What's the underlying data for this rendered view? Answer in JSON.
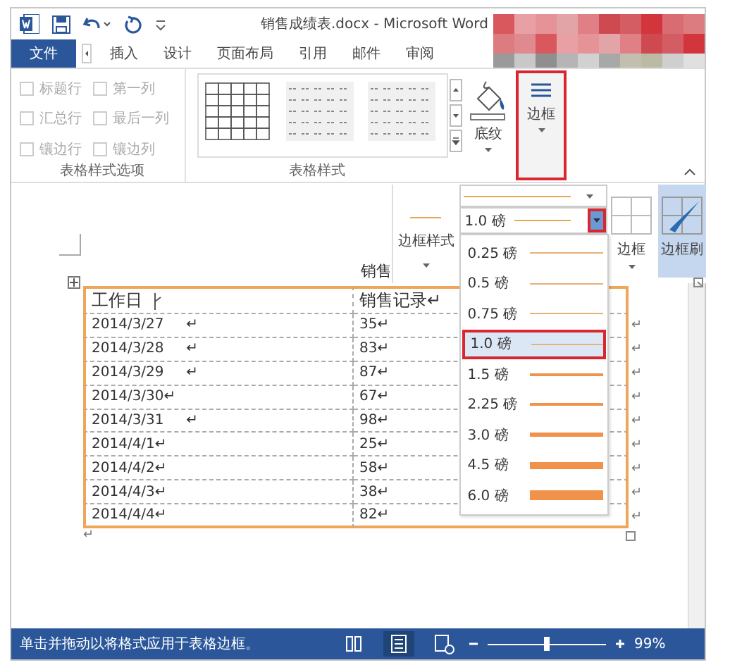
{
  "title_bar": {
    "title": "销售成绩表.docx - Microsoft Word"
  },
  "tabs": [
    {
      "label": "文件",
      "kind": "file"
    },
    {
      "label": "插入",
      "kind": "tab"
    },
    {
      "label": "设计",
      "kind": "tab"
    },
    {
      "label": "页面布局",
      "kind": "tab"
    },
    {
      "label": "引用",
      "kind": "tab"
    },
    {
      "label": "邮件",
      "kind": "tab"
    },
    {
      "label": "审阅",
      "kind": "tab"
    }
  ],
  "style_options": {
    "label": "表格样式选项",
    "options": [
      {
        "label": "标题行",
        "checked": false
      },
      {
        "label": "第一列",
        "checked": false
      },
      {
        "label": "汇总行",
        "checked": false
      },
      {
        "label": "最后一列",
        "checked": false
      },
      {
        "label": "镶边行",
        "checked": false
      },
      {
        "label": "镶边列",
        "checked": false
      }
    ]
  },
  "table_styles": {
    "label": "表格样式",
    "shading_button": "底纹",
    "borders_button": {
      "label": "边框",
      "highlighted": true
    }
  },
  "border_panel": {
    "style_button": "边框样式",
    "weight_combo": {
      "value": "1.0 磅",
      "highlighted": true
    },
    "borders_button": "边框",
    "painter_button": {
      "label": "边框刷",
      "on": true
    }
  },
  "weight_menu": [
    {
      "label": "0.25 磅",
      "selected": false
    },
    {
      "label": "0.5 磅",
      "selected": false
    },
    {
      "label": "0.75 磅",
      "selected": false
    },
    {
      "label": "1.0 磅",
      "selected": true
    },
    {
      "label": "1.5 磅",
      "selected": false
    },
    {
      "label": "2.25 磅",
      "selected": false
    },
    {
      "label": "3.0 磅",
      "selected": false
    },
    {
      "label": "4.5 磅",
      "selected": false
    },
    {
      "label": "6.0 磅",
      "selected": false
    }
  ],
  "document": {
    "title": "销售",
    "table": {
      "header": [
        "工作日",
        "销售记录↵"
      ],
      "rows": [
        {
          "cells": [
            "2014/3/27     ↵",
            "35↵"
          ],
          "end": "↵"
        },
        {
          "cells": [
            "2014/3/28     ↵",
            "83↵"
          ],
          "end": "↵"
        },
        {
          "cells": [
            "2014/3/29     ↵",
            "87↵"
          ],
          "end": "↵"
        },
        {
          "cells": [
            "2014/3/30↵",
            "67↵"
          ],
          "end": "↵"
        },
        {
          "cells": [
            "2014/3/31     ↵",
            "98↵"
          ],
          "end": "↵"
        },
        {
          "cells": [
            "2014/4/1↵",
            "25↵"
          ],
          "end": "↵"
        },
        {
          "cells": [
            "2014/4/2↵",
            "58↵"
          ],
          "end": "↵"
        },
        {
          "cells": [
            "2014/4/3↵",
            "38↵"
          ],
          "end": "↵"
        },
        {
          "cells": [
            "2014/4/4↵",
            "82↵"
          ],
          "end": "↵"
        }
      ]
    },
    "paragraph_mark": "↵"
  },
  "status_bar": {
    "text": "单击并拖动以将格式应用于表格边框。",
    "zoom": "99%",
    "zoom_level": {
      "level": 0.5
    }
  }
}
